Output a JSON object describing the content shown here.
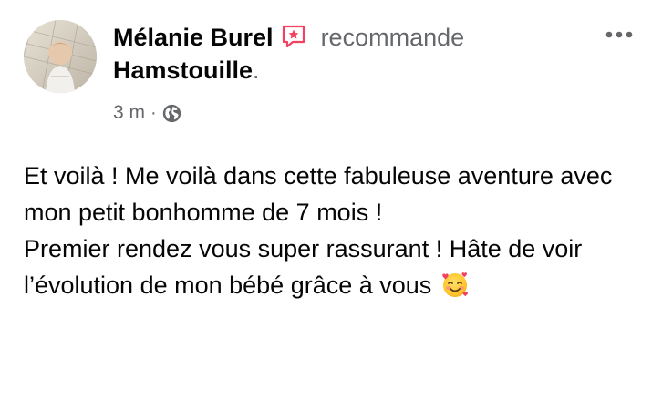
{
  "post": {
    "author": "Mélanie Burel",
    "action": "recommande",
    "page": "Hamstouille",
    "period": ".",
    "time": "3 m",
    "separator": "·",
    "audience_icon": "globe-icon",
    "more_icon": "more-options-icon",
    "recommend_icon": "recommend-badge-icon",
    "body": {
      "paragraph1": "Et voilà ! Me voilà dans cette fabuleuse aventure avec mon petit bonhomme de 7 mois !",
      "paragraph2": "Premier rendez vous super rassurant ! Hâte de voir l’évolution de mon bébé grâce à vous",
      "emoji": "smiling-face-with-hearts-icon"
    }
  },
  "colors": {
    "text_primary": "#050505",
    "text_secondary": "#65676b",
    "recommend_badge": "#f3425f",
    "background": "#ffffff"
  }
}
